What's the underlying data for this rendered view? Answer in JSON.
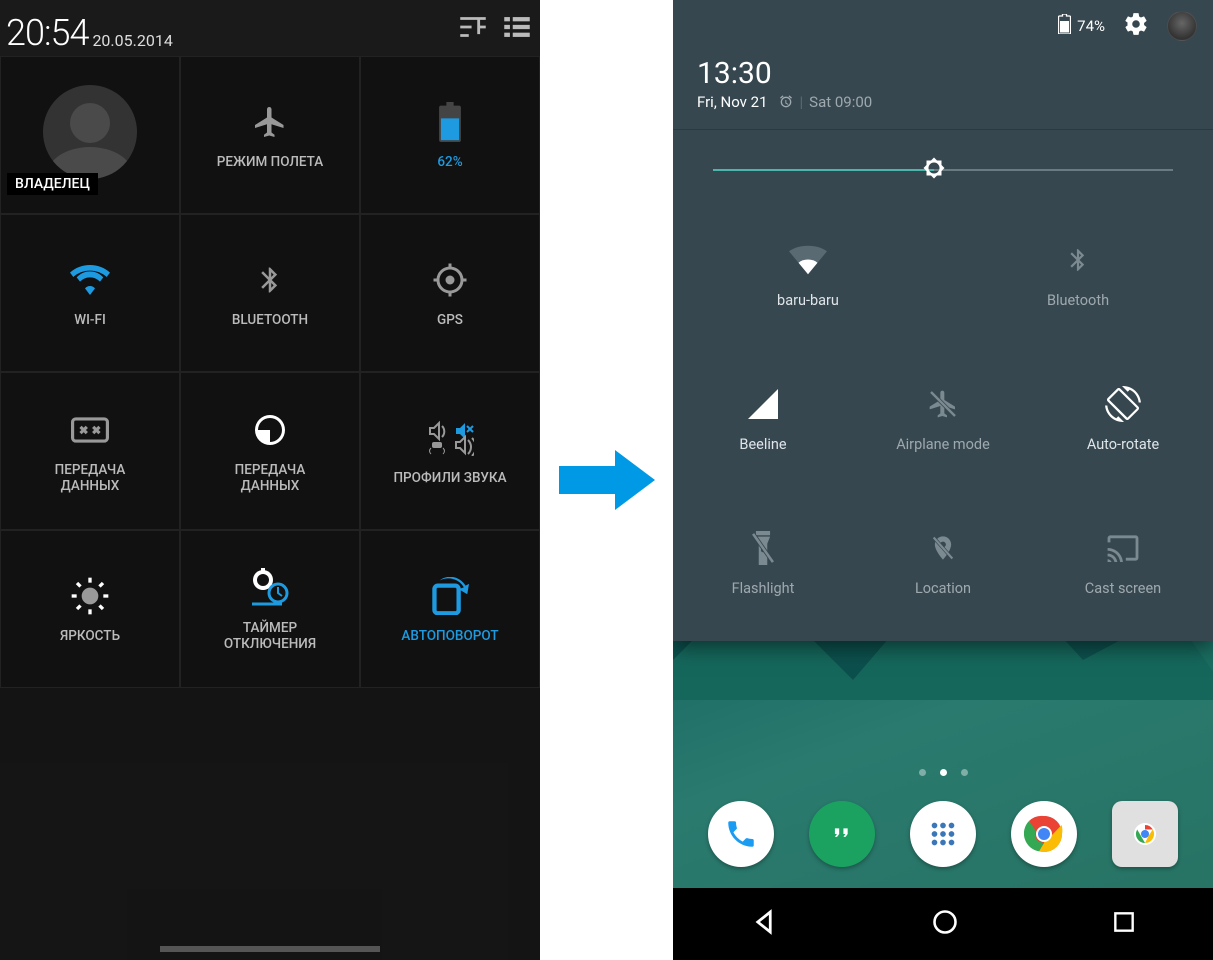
{
  "left": {
    "time": "20:54",
    "date": "20.05.2014",
    "owner": "ВЛАДЕЛЕЦ",
    "tiles": {
      "airplane": "РЕЖИМ ПОЛЕТА",
      "battery": "62%",
      "wifi": "WI-FI",
      "bluetooth": "BLUETOOTH",
      "gps": "GPS",
      "data1": "ПЕРЕДАЧА\nДАННЫХ",
      "data2": "ПЕРЕДАЧА\nДАННЫХ",
      "sound": "ПРОФИЛИ ЗВУКА",
      "brightness": "ЯРКОСТЬ",
      "timer": "ТАЙМЕР\nОТКЛЮЧЕНИЯ",
      "rotate": "АВТОПОВОРОТ"
    }
  },
  "right": {
    "battery": "74%",
    "time": "13:30",
    "date": "Fri, Nov 21",
    "alarm": "Sat 09:00",
    "brightness_pct": 48,
    "tiles": {
      "wifi": "baru-baru",
      "bluetooth": "Bluetooth",
      "signal": "Beeline",
      "airplane": "Airplane mode",
      "rotate": "Auto-rotate",
      "flash": "Flashlight",
      "location": "Location",
      "cast": "Cast screen"
    }
  }
}
